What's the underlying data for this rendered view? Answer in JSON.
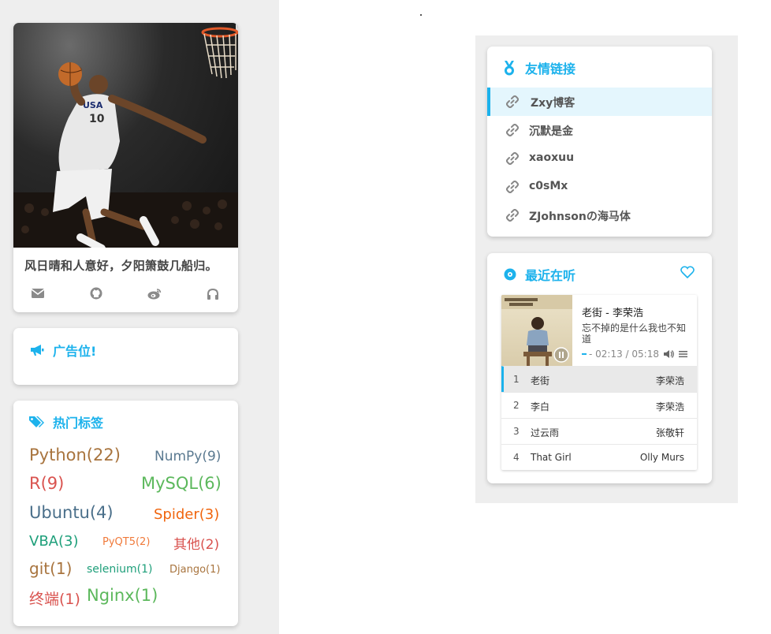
{
  "profile": {
    "motto": "风日晴和人意好，夕阳箫鼓几船归。",
    "social_icons": [
      "envelope-icon",
      "github-icon",
      "weibo-icon",
      "headphones-icon"
    ]
  },
  "ad": {
    "title": "广告位!",
    "icon": "bullhorn-icon"
  },
  "tags": {
    "title": "热门标签",
    "icon": "tags-icon",
    "items": [
      {
        "label": "Python(22)",
        "color": "#a8743e"
      },
      {
        "label": "NumPy(9)",
        "color": "#5b7a91"
      },
      {
        "label": "R(9)",
        "color": "#d9534f"
      },
      {
        "label": "MySQL(6)",
        "color": "#5cb85c"
      },
      {
        "label": "Ubuntu(4)",
        "color": "#4a6f8a"
      },
      {
        "label": "Spider(3)",
        "color": "#f0650e"
      },
      {
        "label": "VBA(3)",
        "color": "#1e9f7a"
      },
      {
        "label": "PyQT5(2)",
        "color": "#f07a3a"
      },
      {
        "label": "其他(2)",
        "color": "#d9534f"
      },
      {
        "label": "git(1)",
        "color": "#a8743e"
      },
      {
        "label": "selenium(1)",
        "color": "#1e9f7a"
      },
      {
        "label": "Django(1)",
        "color": "#a8743e"
      },
      {
        "label": "终端(1)",
        "color": "#d9534f"
      },
      {
        "label": "Nginx(1)",
        "color": "#5cb85c"
      }
    ]
  },
  "friends": {
    "title": "友情链接",
    "icon": "medal-icon",
    "links": [
      {
        "label": "Zxy博客",
        "active": true
      },
      {
        "label": "沉默是金"
      },
      {
        "label": "xaoxuu"
      },
      {
        "label": "c0sMx"
      },
      {
        "label": "ZJohnsonの海马体"
      }
    ]
  },
  "music": {
    "title": "最近在听",
    "icon": "disc-icon",
    "now_playing": {
      "title": "老街 - 李荣浩",
      "lyric": "忘不掉的是什么我也不知道",
      "time": "- 02:13 / 05:18",
      "progress": 0.42
    },
    "playlist": [
      {
        "num": "1",
        "title": "老街",
        "artist": "李荣浩",
        "playing": true
      },
      {
        "num": "2",
        "title": "李白",
        "artist": "李荣浩"
      },
      {
        "num": "3",
        "title": "过云雨",
        "artist": "张敬轩"
      },
      {
        "num": "4",
        "title": "That Girl",
        "artist": "Olly Murs"
      }
    ]
  },
  "colors": {
    "accent": "#1cb2ec",
    "panel_bg": "#eeeeee"
  }
}
